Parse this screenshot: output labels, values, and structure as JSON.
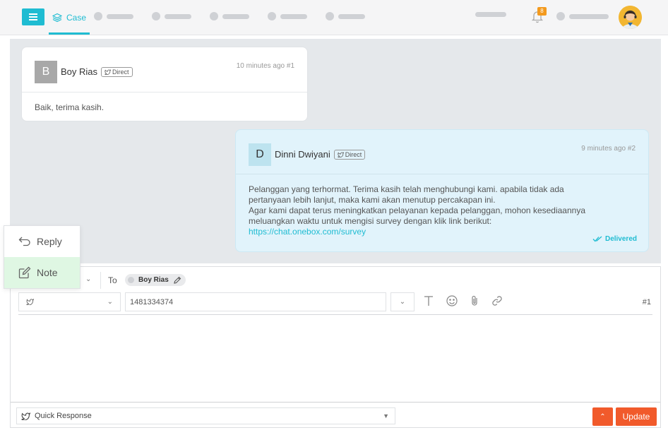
{
  "nav": {
    "case_label": "Case",
    "notification_count": "8"
  },
  "messages": [
    {
      "initial": "B",
      "name": "Boy Rias",
      "channel_tag": "Direct",
      "time": "10 minutes ago #1",
      "body": "Baik, terima kasih."
    },
    {
      "initial": "D",
      "name": "Dinni Dwiyani",
      "channel_tag": "Direct",
      "time": "9 minutes ago #2",
      "body_lines": [
        "Pelanggan yang terhormat. Terima kasih telah menghubungi kami. apabila tidak ada",
        "pertanyaan lebih lanjut, maka kami akan menutup percakapan ini.",
        "Agar kami dapat terus meningkatkan pelayanan kepada pelanggan, mohon kesediaannya",
        "meluangkan waktu untuk mengisi survey dengan klik link berikut:"
      ],
      "link": "https://chat.onebox.com/survey",
      "status": "Delivered"
    }
  ],
  "reply_menu": {
    "items": [
      {
        "label": "Reply",
        "icon": "reply-icon"
      },
      {
        "label": "Note",
        "icon": "note-icon"
      }
    ]
  },
  "composer": {
    "to_label": "To",
    "to_recipient": "Boy Rias",
    "account_id": "1481334374",
    "thread_number": "#1",
    "quick_response_label": "Quick Response",
    "update_label": "Update"
  },
  "colors": {
    "accent": "#1fbcd2",
    "action": "#f15a2b",
    "note_highlight": "#dff7e3",
    "outgoing_bubble": "#e1f3fb"
  }
}
